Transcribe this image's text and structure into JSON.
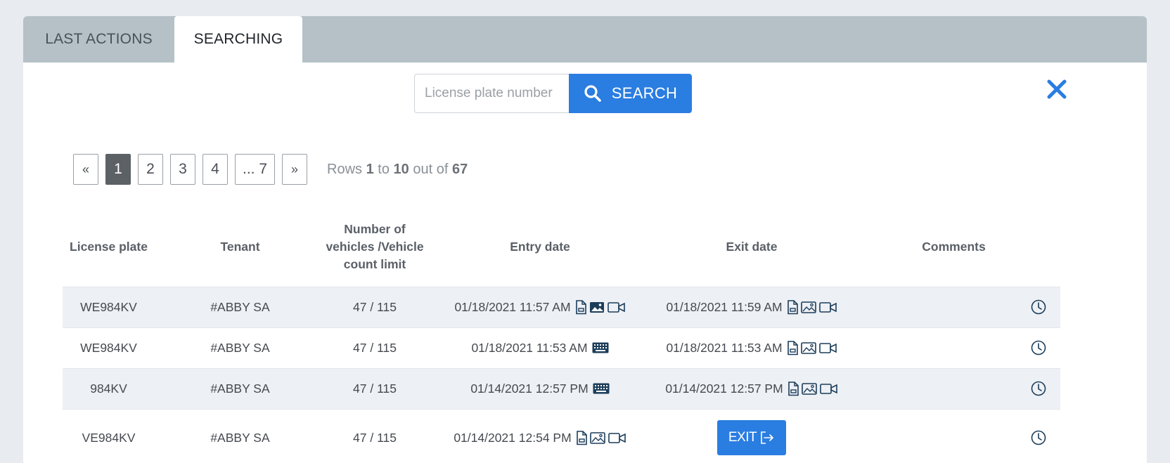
{
  "tabs": [
    {
      "label": "LAST ACTIONS"
    },
    {
      "label": "SEARCHING"
    }
  ],
  "search": {
    "placeholder": "License plate number",
    "value": "",
    "button_label": "SEARCH"
  },
  "pagination": {
    "prev": "«",
    "pages": [
      "1",
      "2",
      "3",
      "4",
      "... 7"
    ],
    "next": "»",
    "active": "1",
    "rows_label": "Rows",
    "rows_from": "1",
    "to_label": "to",
    "rows_to": "10",
    "out_of_label": "out of",
    "rows_total": "67"
  },
  "table": {
    "columns": [
      "License plate",
      "Tenant",
      "Number of vehicles /Vehicle count limit",
      "Entry date",
      "Exit date",
      "Comments"
    ],
    "rows": [
      {
        "plate": "WE984KV",
        "tenant": "#ABBY SA",
        "count": "47 / 115",
        "entry": "01/18/2021 11:57 AM",
        "entry_icons": "doc-image-video",
        "exit": "01/18/2021 11:59 AM",
        "exit_icons": "doc-image-video"
      },
      {
        "plate": "WE984KV",
        "tenant": "#ABBY SA",
        "count": "47 / 115",
        "entry": "01/18/2021 11:53 AM",
        "entry_icons": "keyboard",
        "exit": "01/18/2021 11:53 AM",
        "exit_icons": "doc-image-video"
      },
      {
        "plate": "984KV",
        "tenant": "#ABBY SA",
        "count": "47 / 115",
        "entry": "01/14/2021 12:57 PM",
        "entry_icons": "keyboard",
        "exit": "01/14/2021 12:57 PM",
        "exit_icons": "doc-image-video"
      },
      {
        "plate": "VE984KV",
        "tenant": "#ABBY SA",
        "count": "47 / 115",
        "entry": "01/14/2021 12:54 PM",
        "entry_icons": "doc-image-video",
        "exit": "",
        "exit_button": "EXIT"
      }
    ]
  },
  "colors": {
    "accent": "#2a7de1",
    "tab_bar": "#b5c1c7",
    "icon": "#1c3d5a"
  }
}
